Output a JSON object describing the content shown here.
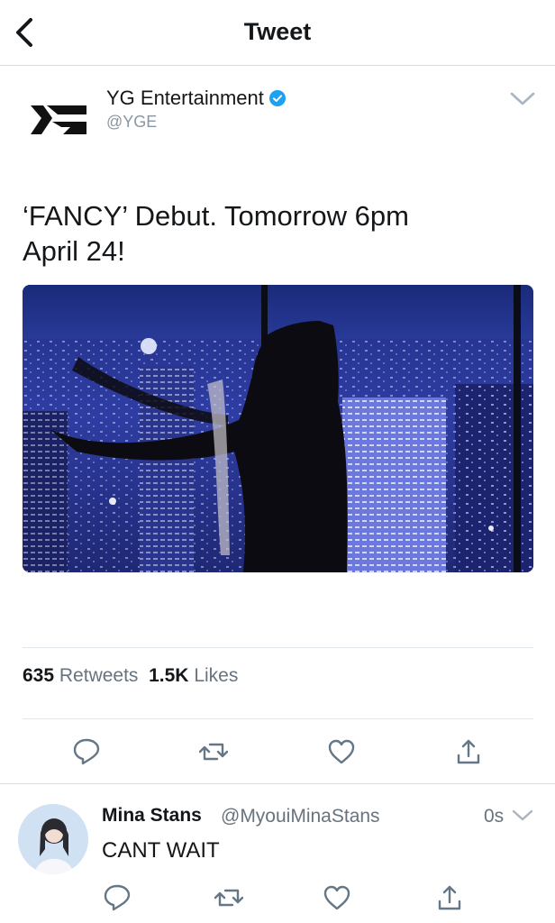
{
  "header": {
    "title": "Tweet",
    "back_icon": "chevron-left-icon"
  },
  "tweet": {
    "author_name": "YG Entertainment",
    "author_handle": "@YGE",
    "verified": true,
    "text_line1": "‘FANCY’ Debut. Tomorrow 6pm",
    "text_line2": "April 24!",
    "media_icon": "city-night-dancer-image",
    "retweets_count": "635",
    "retweets_label": "Retweets",
    "likes_count": "1.5K",
    "likes_label": "Likes",
    "actions": [
      "reply-icon",
      "retweet-icon",
      "like-icon",
      "share-icon"
    ]
  },
  "reply": {
    "author_name": "Mina Stans",
    "author_handle": "@MyouiMinaStans",
    "time": "0s",
    "text": "CANT WAIT"
  },
  "colors": {
    "accent": "#1da1f2",
    "muted": "#67737f",
    "icon": "#657786"
  }
}
